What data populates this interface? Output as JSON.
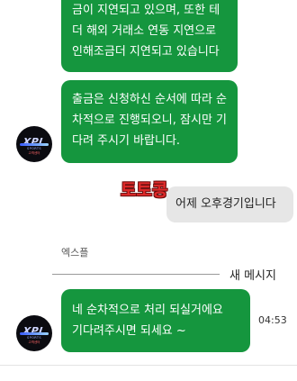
{
  "messages": {
    "m1_lines": [
      "금이 지연되고 있으며, 또한 테",
      "더 해외 거래소 연동 지연으로",
      "인해조금더 지연되고 있습니다"
    ],
    "m2_lines": [
      "출금은 신청하신 순서에 따라 순",
      "차적으로 진행되오니, 잠시만 기",
      "다려 주시기 바랍니다."
    ],
    "user_reply": "어제 오후경기입니다",
    "m3_lines": [
      "네 순차적으로 처리 되실거에요",
      "기다려주시면 되세요 ~"
    ],
    "m3_time": "04:53"
  },
  "watermark": "토토콩",
  "sender_name": "엑스플",
  "divider_label": "새 메시지",
  "avatar": {
    "logo": "XPL",
    "sub": "SPORTS",
    "kr": "고객센터"
  },
  "colors": {
    "green_bubble": "#15963e",
    "gray_bubble": "#e6e6e6",
    "watermark": "#e02a2a"
  }
}
